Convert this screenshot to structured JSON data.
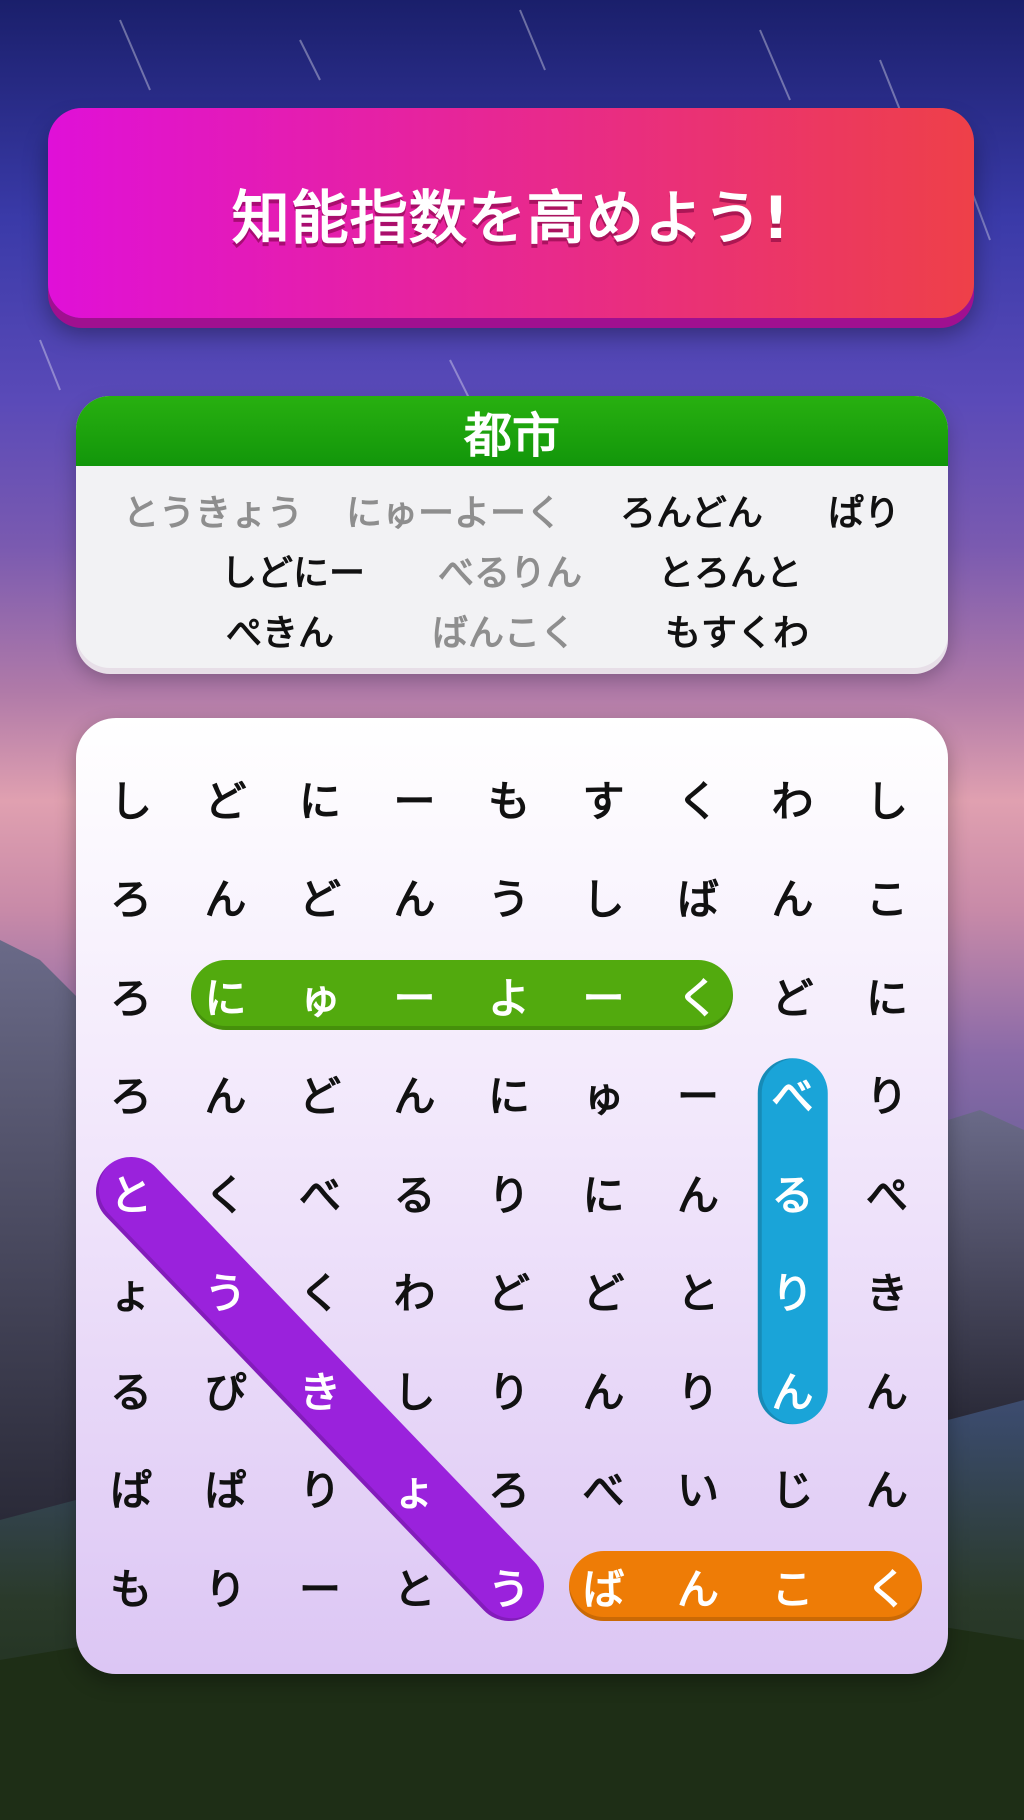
{
  "banner": {
    "title": "知能指数を高めよう!"
  },
  "category": {
    "title": "都市"
  },
  "words": [
    {
      "text": "とうきょう",
      "found": true
    },
    {
      "text": "にゅーよーく",
      "found": true
    },
    {
      "text": "ろんどん",
      "found": false
    },
    {
      "text": "ぱり",
      "found": false
    },
    {
      "text": "しどにー",
      "found": false
    },
    {
      "text": "べるりん",
      "found": true
    },
    {
      "text": "とろんと",
      "found": false
    },
    {
      "text": "ぺきん",
      "found": false
    },
    {
      "text": "ばんこく",
      "found": true
    },
    {
      "text": "もすくわ",
      "found": false
    }
  ],
  "grid": [
    [
      "し",
      "ど",
      "に",
      "ー",
      "も",
      "す",
      "く",
      "わ",
      "し"
    ],
    [
      "ろ",
      "ん",
      "ど",
      "ん",
      "う",
      "し",
      "ば",
      "ん",
      "こ"
    ],
    [
      "ろ",
      "に",
      "ゅ",
      "ー",
      "よ",
      "ー",
      "く",
      "ど",
      "に"
    ],
    [
      "ろ",
      "ん",
      "ど",
      "ん",
      "に",
      "ゅ",
      "ー",
      "べ",
      "り"
    ],
    [
      "と",
      "く",
      "べ",
      "る",
      "り",
      "に",
      "ん",
      "る",
      "ぺ"
    ],
    [
      "ょ",
      "う",
      "く",
      "わ",
      "ど",
      "ど",
      "と",
      "り",
      "き"
    ],
    [
      "る",
      "ぴ",
      "き",
      "し",
      "り",
      "ん",
      "り",
      "ん",
      "ん"
    ],
    [
      "ぱ",
      "ぱ",
      "り",
      "ょ",
      "ろ",
      "べ",
      "い",
      "じ",
      "ん"
    ],
    [
      "も",
      "り",
      "ー",
      "と",
      "う",
      "ば",
      "ん",
      "こ",
      "く"
    ]
  ],
  "highlights": [
    {
      "word": "にゅーよーく",
      "color": "#52aa0e",
      "cells": [
        [
          2,
          1
        ],
        [
          2,
          2
        ],
        [
          2,
          3
        ],
        [
          2,
          4
        ],
        [
          2,
          5
        ],
        [
          2,
          6
        ]
      ]
    },
    {
      "word": "べるりん",
      "color": "#1aa4d8",
      "cells": [
        [
          3,
          7
        ],
        [
          4,
          7
        ],
        [
          5,
          7
        ],
        [
          6,
          7
        ]
      ]
    },
    {
      "word": "とうきょう",
      "color": "#9a22dc",
      "cells": [
        [
          4,
          0
        ],
        [
          5,
          1
        ],
        [
          6,
          2
        ],
        [
          7,
          3
        ],
        [
          8,
          4
        ]
      ]
    },
    {
      "word": "ばんこく",
      "color": "#ee7c06",
      "cells": [
        [
          8,
          5
        ],
        [
          8,
          6
        ],
        [
          8,
          7
        ],
        [
          8,
          8
        ]
      ]
    }
  ]
}
